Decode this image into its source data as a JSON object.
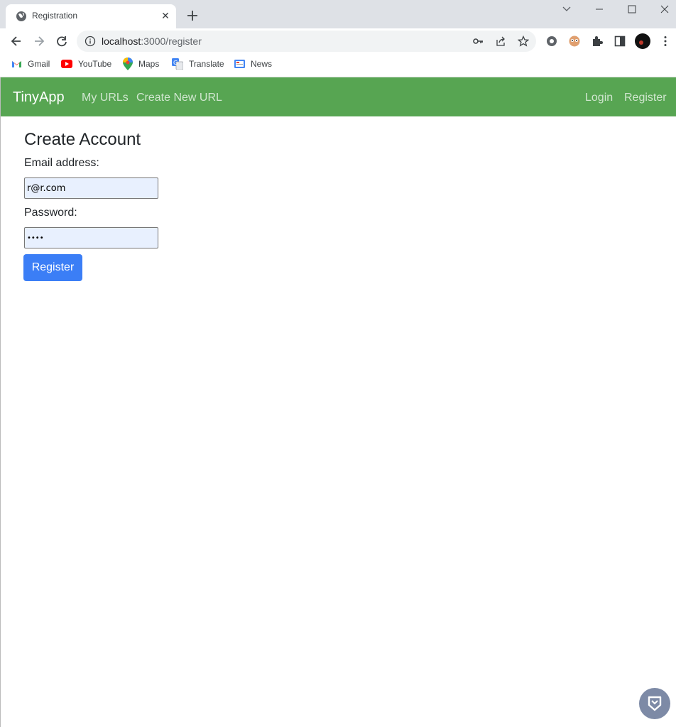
{
  "browser": {
    "tab_title": "Registration",
    "url_host": "localhost",
    "url_path": ":3000/register",
    "bookmarks": [
      {
        "label": "Gmail",
        "icon": "gmail-icon"
      },
      {
        "label": "YouTube",
        "icon": "youtube-icon"
      },
      {
        "label": "Maps",
        "icon": "maps-icon"
      },
      {
        "label": "Translate",
        "icon": "translate-icon"
      },
      {
        "label": "News",
        "icon": "news-icon"
      }
    ]
  },
  "navbar": {
    "brand": "TinyApp",
    "links": [
      "My URLs",
      "Create New URL"
    ],
    "right_links": [
      "Login",
      "Register"
    ],
    "color": "#57a552"
  },
  "form": {
    "heading": "Create Account",
    "email_label": "Email address:",
    "email_value": "r@r.com",
    "password_label": "Password:",
    "password_value": "••••",
    "submit_label": "Register",
    "button_color": "#3b7ef6"
  }
}
